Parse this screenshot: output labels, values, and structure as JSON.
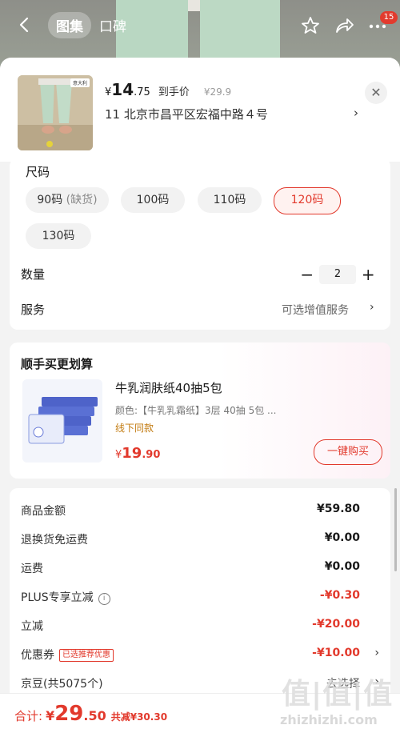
{
  "nav": {
    "tabs": [
      "图集",
      "口碑"
    ],
    "badge": "15"
  },
  "product": {
    "thumb_tag": "意大利",
    "price_currency": "¥",
    "price_int": "14",
    "price_dec": ".75",
    "price_note": "到手价",
    "orig_price": "¥29.9",
    "address": "11  北京市昌平区宏福中路４号",
    "address_arrow": "›"
  },
  "size": {
    "title": "尺码",
    "options": [
      {
        "label": "90码",
        "note": "(缺货)"
      },
      {
        "label": "100码"
      },
      {
        "label": "110码"
      },
      {
        "label": "120码",
        "selected": true
      },
      {
        "label": "130码"
      }
    ]
  },
  "quantity": {
    "label": "数量",
    "minus": "−",
    "value": "2",
    "plus": "+"
  },
  "service": {
    "label": "服务",
    "value": "可选增值服务",
    "arrow": "›"
  },
  "bundle": {
    "title": "顺手买更划算",
    "name": "牛乳润肤纸40抽5包",
    "spec": "颜色:【牛乳乳霜纸】3层 40抽 5包  ...",
    "tag": "线下同款",
    "price_currency": "¥",
    "price_int": "19",
    "price_dec": ".90",
    "buy_label": "一键购买"
  },
  "summary": [
    {
      "label": "商品金额",
      "value": "¥59.80"
    },
    {
      "label": "退换货免运费",
      "value": "¥0.00"
    },
    {
      "label": "运费",
      "value": "¥0.00"
    },
    {
      "label": "PLUS专享立减",
      "value": "-¥0.30",
      "red": true,
      "info": "i"
    },
    {
      "label": "立减",
      "value": "-¥20.00",
      "red": true
    },
    {
      "label": "优惠券",
      "value": "-¥10.00",
      "red": true,
      "tag": "已选推荐优惠",
      "arrow": "›"
    },
    {
      "label": "京豆(共5075个)",
      "value": "去选择",
      "arrow": "›"
    }
  ],
  "total": {
    "label": "合计:",
    "currency": "¥",
    "int": "29",
    "dec": ".50",
    "saving": "共减¥30.30"
  },
  "watermark": {
    "text": "值|值|值",
    "url": "zhizhizhi.com"
  },
  "colors": {
    "accent": "#e2392c",
    "sheet_bg": "#f3f3f3"
  }
}
